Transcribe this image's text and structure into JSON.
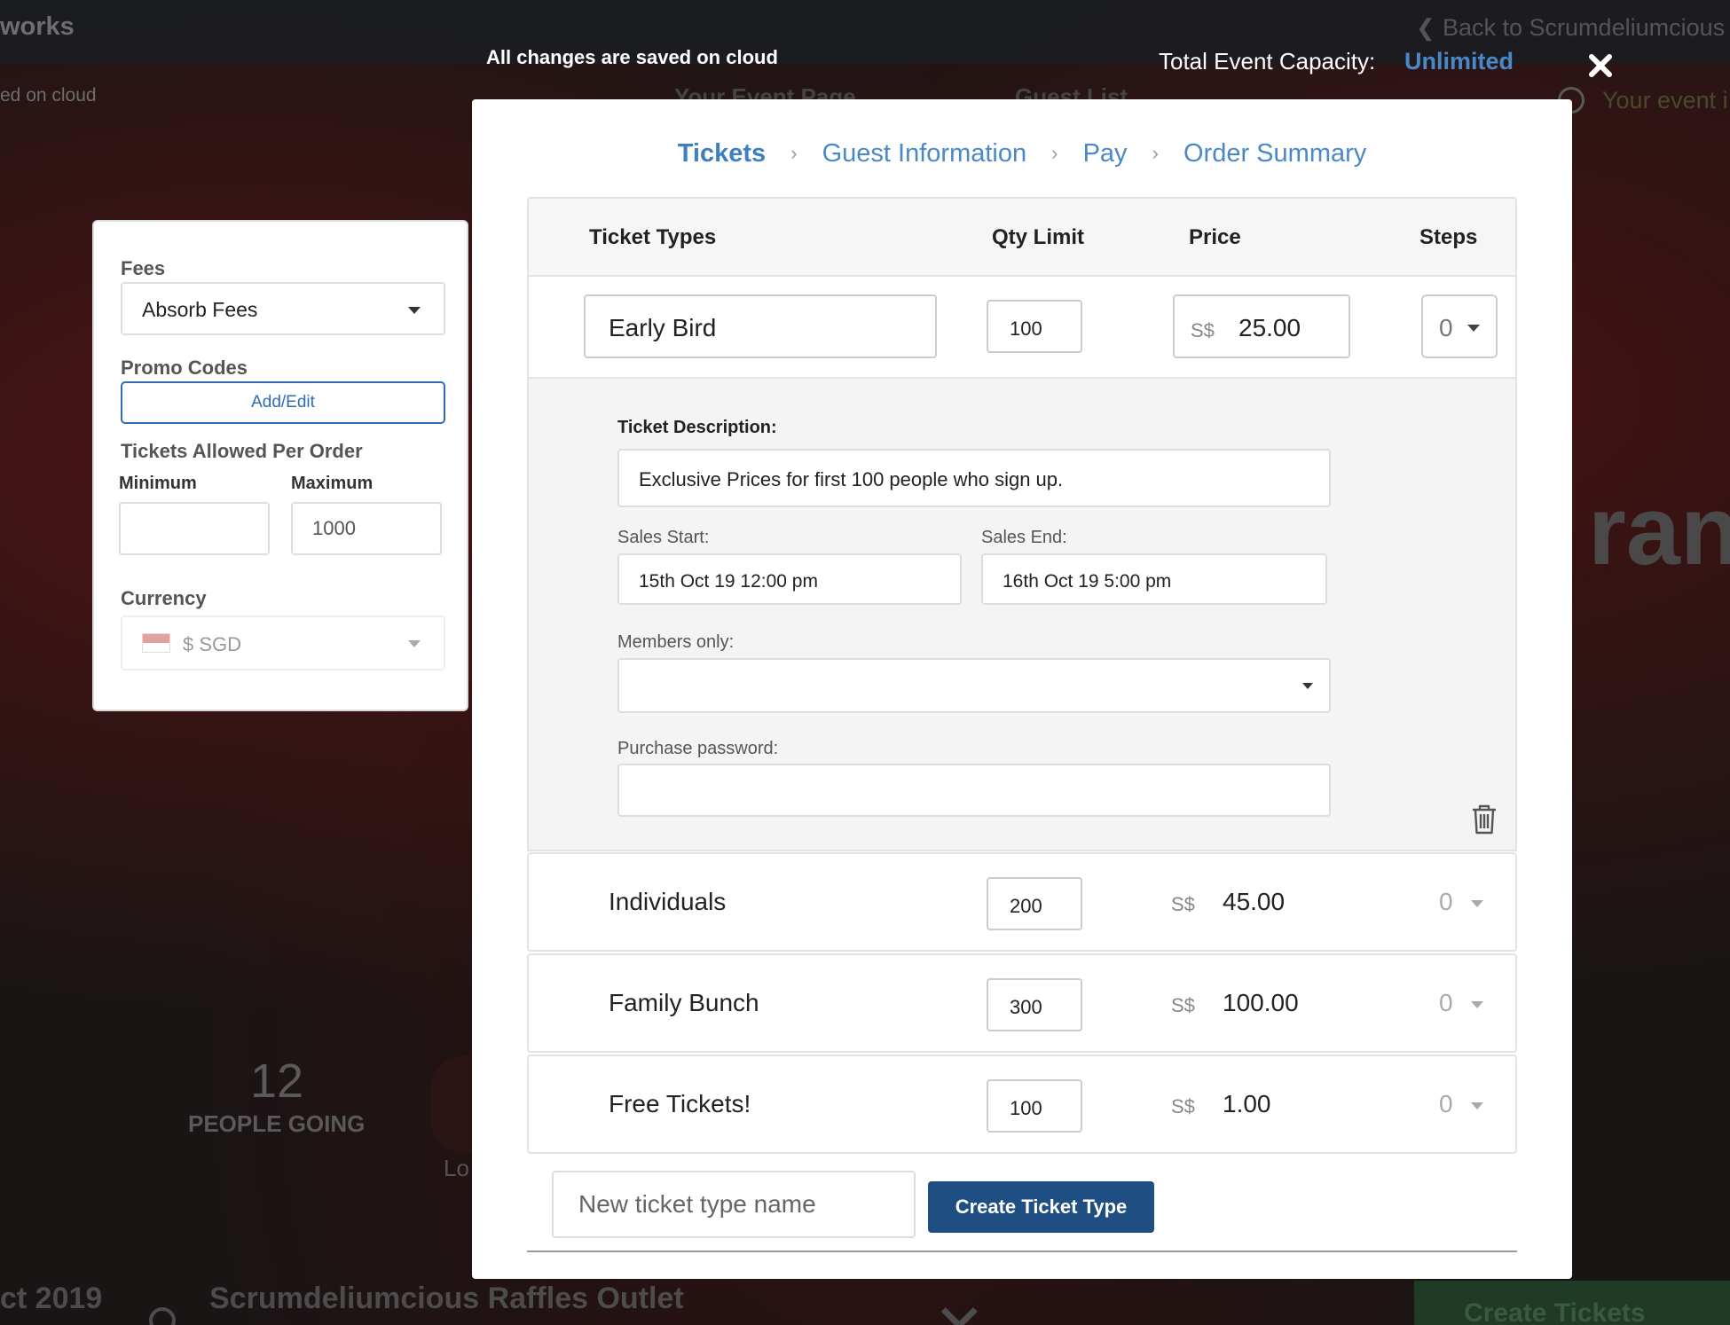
{
  "background": {
    "top_left_fragment": "works",
    "saved_fragment": "ed on cloud",
    "back_link": "Back to Scrumdeliumcious",
    "your_event_page": "Your Event Page",
    "guest_list": "Guest List",
    "your_event_fragment": "Your event i",
    "big_text_fragment": "ranc",
    "going_count": "12",
    "going_label": "PEOPLE GOING",
    "lo_fragment": "Lo",
    "date_fragment": "ct 2019",
    "venue": "Scrumdeliumcious Raffles Outlet",
    "create_tickets_fragment": "Create Tickets"
  },
  "modal_top": {
    "saved_message": "All changes are saved on cloud",
    "capacity_label": "Total Event Capacity:",
    "capacity_value": "Unlimited"
  },
  "left_panel": {
    "fees_label": "Fees",
    "fees_value": "Absorb Fees",
    "promo_label": "Promo Codes",
    "promo_button": "Add/Edit",
    "per_order_label": "Tickets Allowed Per Order",
    "min_label": "Minimum",
    "max_label": "Maximum",
    "min_value": "",
    "max_value": "1000",
    "currency_label": "Currency",
    "currency_value": "$ SGD"
  },
  "steps": {
    "tickets": "Tickets",
    "guest_information": "Guest Information",
    "pay": "Pay",
    "order_summary": "Order Summary",
    "separator": "›"
  },
  "table": {
    "col_types": "Ticket Types",
    "col_qty": "Qty Limit",
    "col_price": "Price",
    "col_steps": "Steps"
  },
  "expanded_ticket": {
    "name": "Early Bird",
    "qty": "100",
    "currency": "S$",
    "price": "25.00",
    "steps": "0",
    "description_label": "Ticket Description:",
    "description": "Exclusive Prices for first 100 people who sign up.",
    "sales_start_label": "Sales Start:",
    "sales_start": "15th Oct 19 12:00 pm",
    "sales_end_label": "Sales End:",
    "sales_end": "16th Oct 19 5:00 pm",
    "members_label": "Members only:",
    "members_value": "",
    "password_label": "Purchase password:",
    "password_value": ""
  },
  "tickets": [
    {
      "name": "Individuals",
      "qty": "200",
      "currency": "S$",
      "price": "45.00",
      "steps": "0"
    },
    {
      "name": "Family Bunch",
      "qty": "300",
      "currency": "S$",
      "price": "100.00",
      "steps": "0"
    },
    {
      "name": "Free Tickets!",
      "qty": "100",
      "currency": "S$",
      "price": "1.00",
      "steps": "0"
    }
  ],
  "new_ticket": {
    "placeholder": "New ticket type name",
    "button": "Create Ticket Type"
  },
  "colors": {
    "accent": "#4a89c8",
    "primary_button": "#1f4f82"
  }
}
